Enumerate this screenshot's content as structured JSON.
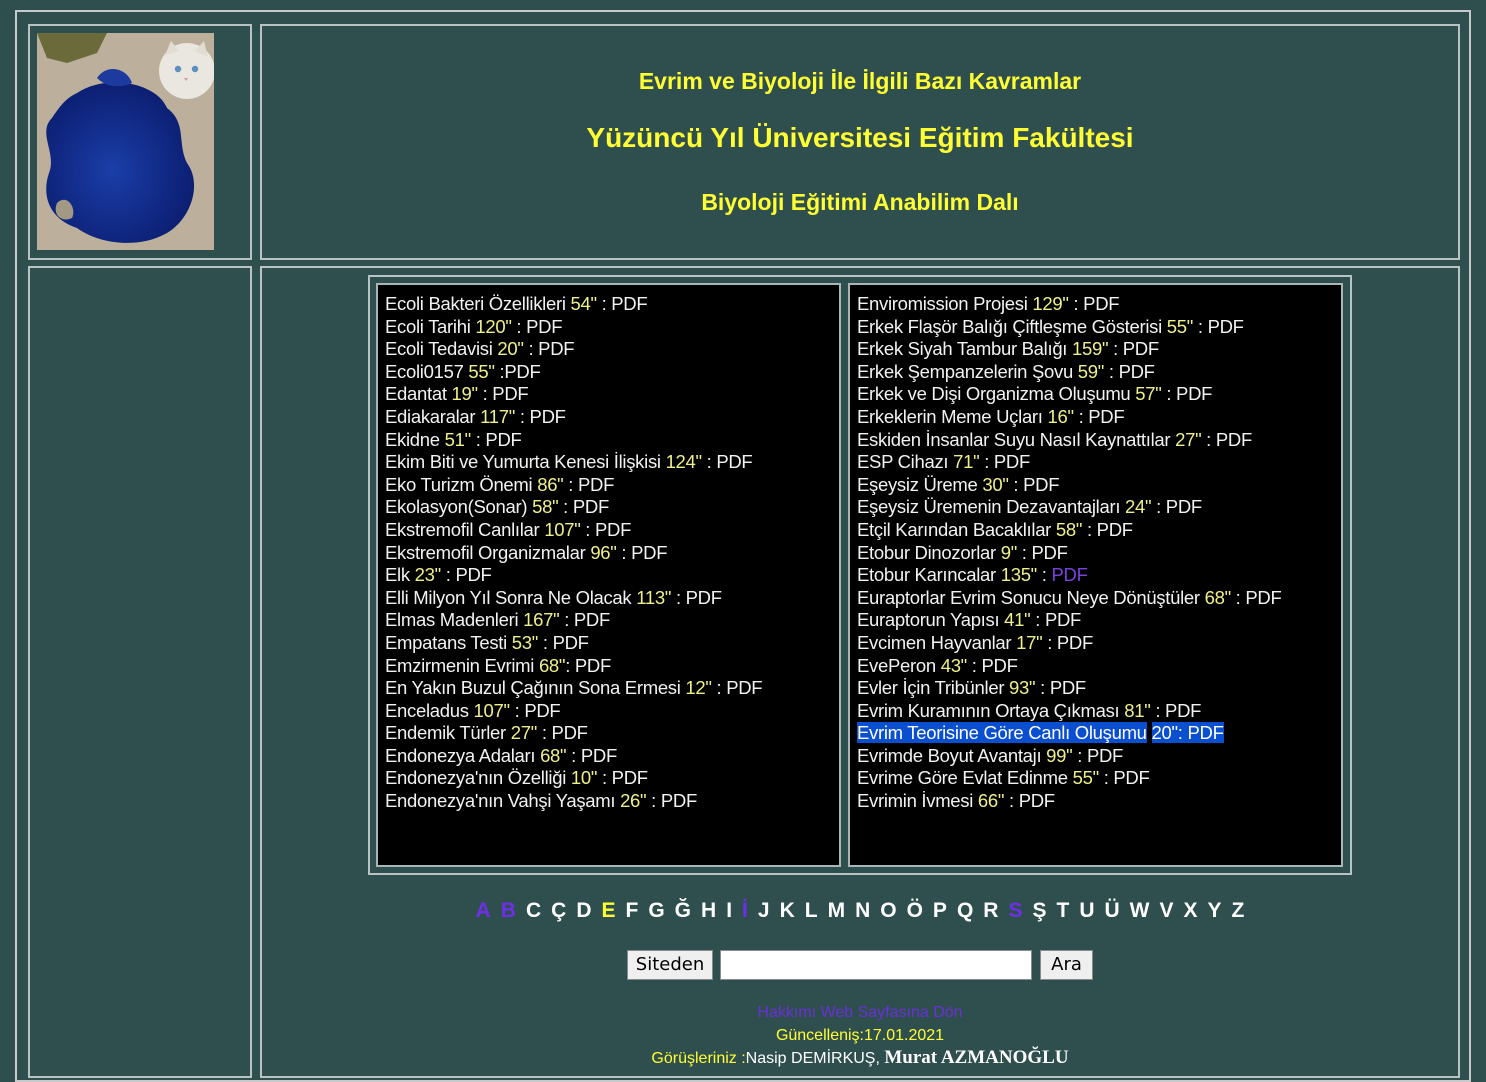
{
  "header": {
    "line1": "Evrim ve Biyoloji İle İlgili Bazı Kavramlar",
    "line2": "Yüzüncü Yıl Üniversitesi Eğitim Fakültesi",
    "line3": "Biyoloji Eğitimi Anabilim Dalı"
  },
  "left_list": [
    {
      "t": "Ecoli Bakteri Özellikleri",
      "d": "54\"",
      "sep": " : ",
      "pdf": "PDF"
    },
    {
      "t": "Ecoli Tarihi",
      "d": "120\"",
      "sep": " : ",
      "pdf": "PDF"
    },
    {
      "t": "Ecoli Tedavisi",
      "d": "20\"",
      "sep": " : ",
      "pdf": "PDF"
    },
    {
      "t": "Ecoli0157",
      "d": "55\"",
      "sep": " :",
      "pdf": "PDF"
    },
    {
      "t": "Edantat ",
      "d": "19\"",
      "sep": " : ",
      "pdf": "PDF"
    },
    {
      "t": "Ediakaralar",
      "d": "117\"",
      "sep": " : ",
      "pdf": "PDF"
    },
    {
      "t": "Ekidne",
      "d": "51\"",
      "sep": " : ",
      "pdf": "PDF"
    },
    {
      "t": "Ekim Biti ve Yumurta Kenesi İlişkisi",
      "d": "124\"",
      "sep": " : ",
      "pdf": "PDF"
    },
    {
      "t": "Eko Turizm Önemi",
      "d": "86\"",
      "sep": " : ",
      "pdf": "PDF"
    },
    {
      "t": "Ekolasyon(Sonar)",
      "d": "58\"",
      "sep": " : ",
      "pdf": "PDF"
    },
    {
      "t": "Ekstremofil Canlılar",
      "d": "107\"",
      "sep": " : ",
      "pdf": "PDF"
    },
    {
      "t": "Ekstremofil Organizmalar",
      "d": "96\"",
      "sep": " : ",
      "pdf": "PDF"
    },
    {
      "t": "Elk",
      "d": "23\"",
      "sep": " : ",
      "pdf": "PDF"
    },
    {
      "t": "Elli Milyon Yıl Sonra Ne Olacak",
      "d": "113\"",
      "sep": " : ",
      "pdf": "PDF"
    },
    {
      "t": "Elmas Madenleri",
      "d": "167\"",
      "sep": " : ",
      "pdf": "PDF"
    },
    {
      "t": "Empatans Testi",
      "d": "53\"",
      "sep": " : ",
      "pdf": "PDF"
    },
    {
      "t": "Emzirmenin Evrimi",
      "d": "68\"",
      "sep": ": ",
      "pdf": "PDF"
    },
    {
      "t": "En Yakın Buzul Çağının Sona Ermesi",
      "d": "12\"",
      "sep": " : ",
      "pdf": "PDF"
    },
    {
      "t": "Enceladus",
      "d": "107\"",
      "sep": " : ",
      "pdf": "PDF"
    },
    {
      "t": "Endemik Türler",
      "d": "27\"",
      "sep": " : ",
      "pdf": "PDF"
    },
    {
      "t": "Endonezya Adaları",
      "d": "68\"",
      "sep": " : ",
      "pdf": "PDF"
    },
    {
      "t": "Endonezya'nın Özelliği",
      "d": "10\"",
      "sep": " : ",
      "pdf": "PDF"
    },
    {
      "t": "Endonezya'nın Vahşi Yaşamı",
      "d": "26\"",
      "sep": " : ",
      "pdf": "PDF"
    }
  ],
  "right_list": [
    {
      "t": "Enviromission Projesi",
      "d": "129\"",
      "sep": " : ",
      "pdf": "PDF"
    },
    {
      "t": "Erkek Flaşör Balığı Çiftleşme Gösterisi",
      "d": "55\"",
      "sep": " : ",
      "pdf": "PDF"
    },
    {
      "t": "Erkek Siyah Tambur Balığı",
      "d": "159\"",
      "sep": " : ",
      "pdf": "PDF"
    },
    {
      "t": "Erkek Şempanzelerin Şovu",
      "d": "59\"",
      "sep": " : ",
      "pdf": "PDF"
    },
    {
      "t": "Erkek ve Dişi Organizma Oluşumu",
      "d": "57\"",
      "sep": " : ",
      "pdf": "PDF"
    },
    {
      "t": "Erkeklerin Meme Uçları",
      "d": "16\"",
      "sep": " : ",
      "pdf": "PDF"
    },
    {
      "t": "Eskiden İnsanlar Suyu Nasıl Kaynattılar",
      "d": "27\"",
      "sep": " : ",
      "pdf": "PDF"
    },
    {
      "t": "ESP Cihazı",
      "d": "71\"",
      "sep": " : ",
      "pdf": "PDF"
    },
    {
      "t": "Eşeysiz Üreme",
      "d": "30\"",
      "sep": " : ",
      "pdf": "PDF"
    },
    {
      "t": "Eşeysiz Üremenin Dezavantajları",
      "d": "24\"",
      "sep": " : ",
      "pdf": "PDF"
    },
    {
      "t": "Etçil Karından Bacaklılar",
      "d": "58\"",
      "sep": " : ",
      "pdf": "PDF"
    },
    {
      "t": "Etobur Dinozorlar",
      "d": "9\"",
      "sep": " : ",
      "pdf": "PDF"
    },
    {
      "t": "Etobur Karıncalar",
      "d": "135\"",
      "sep": " : ",
      "pdf": "PDF",
      "visited": true
    },
    {
      "t": "Euraptorlar Evrim Sonucu Neye Dönüştüler",
      "d": "68\"",
      "sep": " : ",
      "pdf": "PDF"
    },
    {
      "t": "Euraptorun Yapısı",
      "d": "41\"",
      "sep": " : ",
      "pdf": "PDF"
    },
    {
      "t": "Evcimen Hayvanlar",
      "d": "17\"",
      "sep": " : ",
      "pdf": "PDF"
    },
    {
      "t": "EvePeron",
      "d": "43\"",
      "sep": " : ",
      "pdf": "PDF"
    },
    {
      "t": "Evler İçin Tribünler",
      "d": "93\"",
      "sep": " : ",
      "pdf": "PDF"
    },
    {
      "t": "Evrim Kuramının Ortaya Çıkması",
      "d": "81\"",
      "sep": " : ",
      "pdf": "PDF"
    },
    {
      "t": "Evrim Teorisine Göre Canlı Oluşumu",
      "d": "20\"",
      "sep": ": ",
      "pdf": "PDF",
      "selected": true
    },
    {
      "t": "Evrimde Boyut Avantajı",
      "d": "99\"",
      "sep": " : ",
      "pdf": "PDF"
    },
    {
      "t": "Evrime Göre Evlat Edinme",
      "d": "55\"",
      "sep": " : ",
      "pdf": "PDF"
    },
    {
      "t": "Evrimin İvmesi",
      "d": "66\"",
      "sep": " : ",
      "pdf": "PDF"
    }
  ],
  "alphabet": [
    {
      "l": "A",
      "s": "v"
    },
    {
      "l": "B",
      "s": "v"
    },
    {
      "l": "C",
      "s": "w"
    },
    {
      "l": "Ç",
      "s": "w"
    },
    {
      "l": "D",
      "s": "w"
    },
    {
      "l": "E",
      "s": "y"
    },
    {
      "l": "F",
      "s": "w"
    },
    {
      "l": "G",
      "s": "w"
    },
    {
      "l": "Ğ",
      "s": "w"
    },
    {
      "l": "H",
      "s": "w"
    },
    {
      "l": "I",
      "s": "w"
    },
    {
      "l": "İ",
      "s": "v"
    },
    {
      "l": "J",
      "s": "w"
    },
    {
      "l": "K",
      "s": "w"
    },
    {
      "l": "L",
      "s": "w"
    },
    {
      "l": "M",
      "s": "w"
    },
    {
      "l": "N",
      "s": "w"
    },
    {
      "l": "O",
      "s": "w"
    },
    {
      "l": "Ö",
      "s": "w"
    },
    {
      "l": "P",
      "s": "w"
    },
    {
      "l": "Q",
      "s": "w"
    },
    {
      "l": "R",
      "s": "w"
    },
    {
      "l": "S",
      "s": "v"
    },
    {
      "l": "Ş",
      "s": "w"
    },
    {
      "l": "T",
      "s": "w"
    },
    {
      "l": "U",
      "s": "w"
    },
    {
      "l": "Ü",
      "s": "w"
    },
    {
      "l": "W",
      "s": "w"
    },
    {
      "l": "V",
      "s": "w"
    },
    {
      "l": "X",
      "s": "w"
    },
    {
      "l": "Y",
      "s": "w"
    },
    {
      "l": "Z",
      "s": "w"
    }
  ],
  "search": {
    "site_button": "Siteden",
    "input_value": "",
    "search_button": "Ara"
  },
  "footer": {
    "about": "Hakkımı Web Sayfasına Dön",
    "updated": "Güncelleniş:17.01.2021",
    "feedback_label": "Görüşleriniz :",
    "name1": "Nasip DEMİRKUŞ,",
    "name2": "Murat AZMANOĞLU"
  },
  "colors": {
    "background": "#2f4f4f",
    "header_text": "#ffff33",
    "duration_text": "#f0f08a",
    "visited_link": "#7b3fe0",
    "selection": "#0a4fcf"
  }
}
